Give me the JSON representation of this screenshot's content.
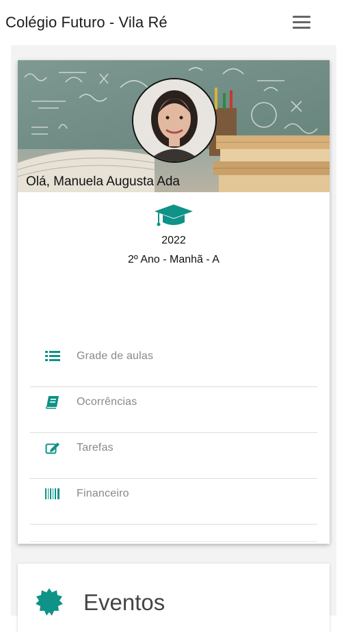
{
  "header": {
    "title": "Colégio Futuro - Vila Ré",
    "menu_icon": "hamburger-menu-icon"
  },
  "profile": {
    "greeting": "Olá, Manuela Augusta Ada",
    "year": "2022",
    "class_info": "2º Ano - Manhã - A",
    "icon": "graduation-cap-icon"
  },
  "menu": {
    "items": [
      {
        "label": "Grade de aulas",
        "icon": "list-icon"
      },
      {
        "label": "Ocorrências",
        "icon": "book-icon"
      },
      {
        "label": "Tarefas",
        "icon": "edit-icon"
      },
      {
        "label": "Financeiro",
        "icon": "barcode-icon"
      }
    ]
  },
  "events": {
    "title": "Eventos",
    "icon": "badge-icon"
  },
  "colors": {
    "accent": "#0f9287",
    "text": "#222222",
    "muted": "#888888"
  }
}
